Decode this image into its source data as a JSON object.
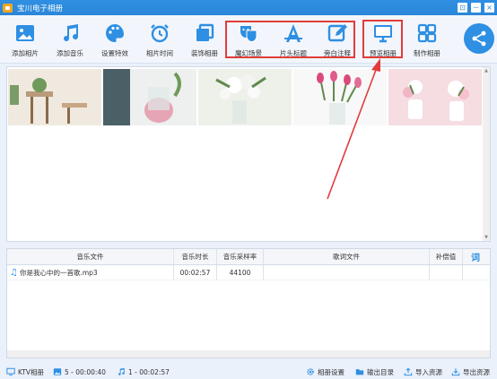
{
  "app": {
    "title": "宝川电子相册"
  },
  "window_controls": {
    "menu": "⊡",
    "minimize": "－",
    "close": "×"
  },
  "toolbar": [
    {
      "id": "add-photo",
      "label": "添加相片",
      "icon": "image-icon"
    },
    {
      "id": "add-music",
      "label": "添加音乐",
      "icon": "music-note-icon"
    },
    {
      "id": "set-effect",
      "label": "设置特效",
      "icon": "palette-icon"
    },
    {
      "id": "photo-time",
      "label": "相片时间",
      "icon": "alarm-clock-icon"
    },
    {
      "id": "decorate",
      "label": "装饰相册",
      "icon": "layers-icon"
    },
    {
      "id": "magic-scene",
      "label": "魔幻场景",
      "icon": "drama-mask-icon"
    },
    {
      "id": "title-caption",
      "label": "片头标题",
      "icon": "letter-a-icon"
    },
    {
      "id": "narration",
      "label": "旁白注释",
      "icon": "edit-icon"
    },
    {
      "id": "preview",
      "label": "预览相册",
      "icon": "monitor-icon"
    },
    {
      "id": "make",
      "label": "制作相册",
      "icon": "grid-icon"
    }
  ],
  "accent_color": "#2f8fe2",
  "highlight_color": "#e23b3b",
  "music_table": {
    "headers": [
      "音乐文件",
      "音乐时长",
      "音乐采样率",
      "歌词文件",
      "补偿值",
      "词"
    ],
    "rows": [
      {
        "file": "你是我心中的一首歌.mp3",
        "duration": "00:02:57",
        "sample_rate": "44100",
        "lyrics": "",
        "offset": ""
      }
    ]
  },
  "status": {
    "ktv": "KTV相册",
    "photos": "5 - 00:00:40",
    "music": "1 - 00:02:57",
    "settings": "相册设置",
    "output_dir": "输出目录",
    "import": "导入资源",
    "export": "导出资源"
  }
}
